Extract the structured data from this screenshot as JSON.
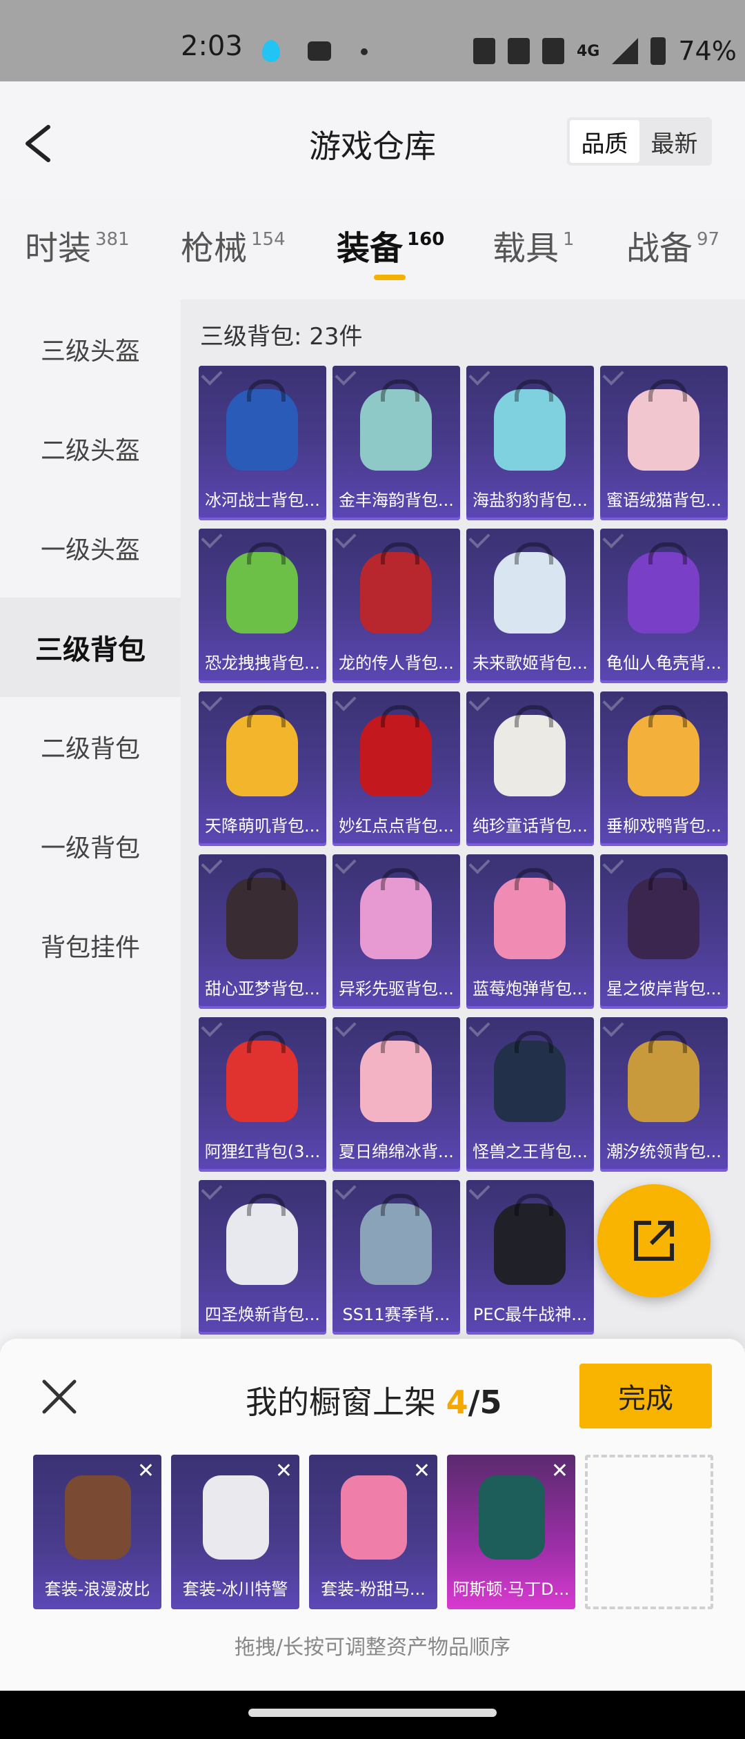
{
  "status_bar": {
    "time": "2:03",
    "network": "4G",
    "battery": "74%"
  },
  "header": {
    "title": "游戏仓库",
    "sort_quality": "品质",
    "sort_newest": "最新"
  },
  "tabs": [
    {
      "label": "时装",
      "count": "381"
    },
    {
      "label": "枪械",
      "count": "154"
    },
    {
      "label": "装备",
      "count": "160"
    },
    {
      "label": "载具",
      "count": "1"
    },
    {
      "label": "战备",
      "count": "97"
    }
  ],
  "sidebar": [
    {
      "label": "三级头盔"
    },
    {
      "label": "二级头盔"
    },
    {
      "label": "一级头盔"
    },
    {
      "label": "三级背包"
    },
    {
      "label": "二级背包"
    },
    {
      "label": "一级背包"
    },
    {
      "label": "背包挂件"
    }
  ],
  "section_title": "三级背包: 23件",
  "items": [
    {
      "label": "冰河战士背包...",
      "color": "#2b5bb8"
    },
    {
      "label": "金丰海韵背包...",
      "color": "#8fc9c7"
    },
    {
      "label": "海盐豹豹背包...",
      "color": "#7fd1e0"
    },
    {
      "label": "蜜语绒猫背包...",
      "color": "#f2c6cf"
    },
    {
      "label": "恐龙拽拽背包...",
      "color": "#6cc047"
    },
    {
      "label": "龙的传人背包...",
      "color": "#b8262e"
    },
    {
      "label": "未来歌姬背包...",
      "color": "#d9e6f2"
    },
    {
      "label": "龟仙人龟壳背...",
      "color": "#7a3fc7"
    },
    {
      "label": "天降萌叽背包...",
      "color": "#f3b52c"
    },
    {
      "label": "妙红点点背包...",
      "color": "#c4181f"
    },
    {
      "label": "纯珍童话背包...",
      "color": "#eceae4"
    },
    {
      "label": "垂柳戏鸭背包...",
      "color": "#f3b03a"
    },
    {
      "label": "甜心亚梦背包...",
      "color": "#3a2c33"
    },
    {
      "label": "异彩先驱背包...",
      "color": "#e79ad2"
    },
    {
      "label": "蓝莓炮弹背包...",
      "color": "#f08cb4"
    },
    {
      "label": "星之彼岸背包...",
      "color": "#3b2650"
    },
    {
      "label": "阿狸红背包(3...",
      "color": "#e0322f"
    },
    {
      "label": "夏日绵绵冰背...",
      "color": "#f3b3c4"
    },
    {
      "label": "怪兽之王背包...",
      "color": "#22304a"
    },
    {
      "label": "潮汐统领背包...",
      "color": "#c99a3b"
    },
    {
      "label": "四圣焕新背包...",
      "color": "#e8e8ef"
    },
    {
      "label": "SS11赛季背...",
      "color": "#8aa3b8"
    },
    {
      "label": "PEC最牛战神...",
      "color": "#202028"
    }
  ],
  "sheet": {
    "title": "我的橱窗上架",
    "current": "4",
    "total": "/5",
    "done": "完成",
    "hint": "拖拽/长按可调整资产物品顺序",
    "slots": [
      {
        "label": "套装-浪漫波比",
        "color": "#7a4a32"
      },
      {
        "label": "套装-冰川特警",
        "color": "#e9e9ee"
      },
      {
        "label": "套装-粉甜马...",
        "color": "#ef7fa8"
      },
      {
        "label": "阿斯顿·马丁D...",
        "color": "#1d5d5a"
      }
    ]
  }
}
